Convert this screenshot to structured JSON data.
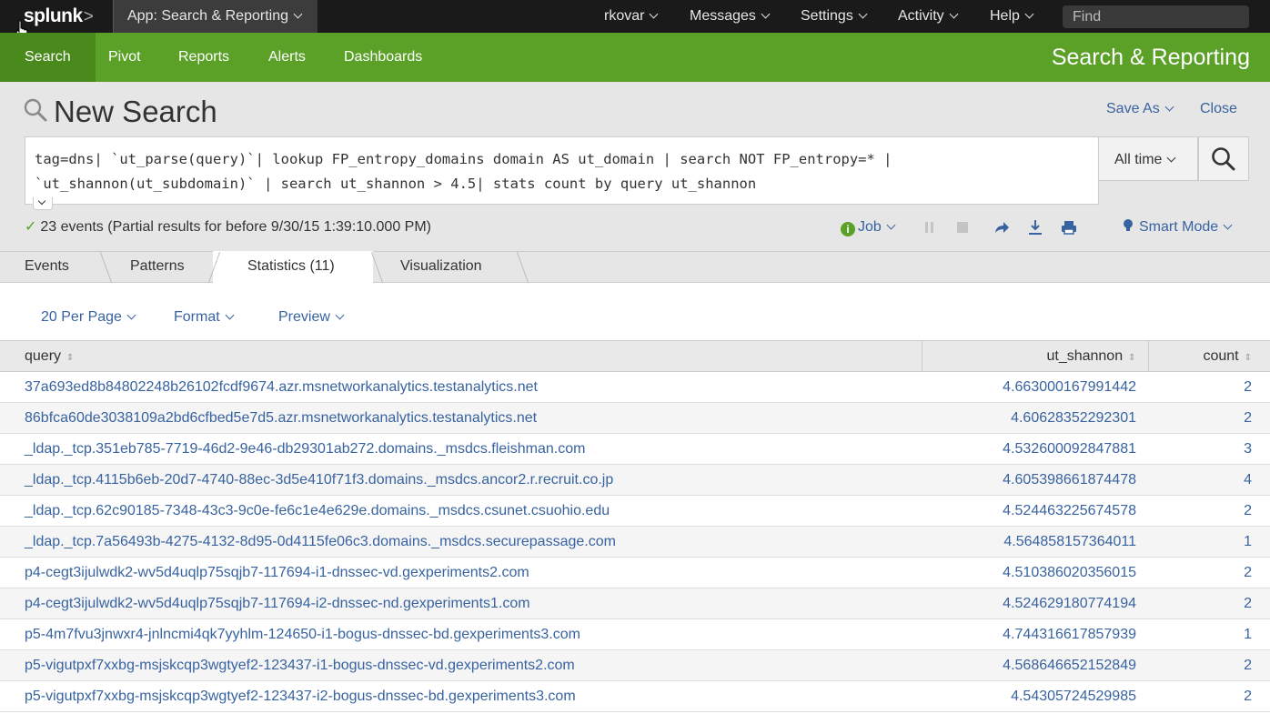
{
  "topbar": {
    "logo": "splunk",
    "logo_suffix": ">",
    "app_menu": "App: Search & Reporting",
    "user": "rkovar",
    "messages": "Messages",
    "settings": "Settings",
    "activity": "Activity",
    "help": "Help",
    "find_placeholder": "Find"
  },
  "appnav": {
    "items": [
      "Search",
      "Pivot",
      "Reports",
      "Alerts",
      "Dashboards"
    ],
    "app_title": "Search & Reporting"
  },
  "search": {
    "page_title": "New Search",
    "save_as": "Save As",
    "close": "Close",
    "query_line1": "tag=dns| `ut_parse(query)`| lookup FP_entropy_domains domain AS ut_domain | search NOT FP_entropy=* |",
    "query_line2": "`ut_shannon(ut_subdomain)` | search ut_shannon > 4.5| stats count by query ut_shannon",
    "time_range": "All time",
    "status_text": "23 events (Partial results for before 9/30/15 1:39:10.000 PM)",
    "job_label": "Job",
    "smart_mode": "Smart Mode"
  },
  "tabs": [
    {
      "label": "Events"
    },
    {
      "label": "Patterns"
    },
    {
      "label": "Statistics (11)"
    },
    {
      "label": "Visualization"
    }
  ],
  "controls": {
    "per_page": "20 Per Page",
    "format": "Format",
    "preview": "Preview"
  },
  "table": {
    "headers": [
      "query",
      "ut_shannon",
      "count"
    ],
    "rows": [
      [
        "37a693ed8b84802248b26102fcdf9674.azr.msnetworkanalytics.testanalytics.net",
        "4.663000167991442",
        "2"
      ],
      [
        "86bfca60de3038109a2bd6cfbed5e7d5.azr.msnetworkanalytics.testanalytics.net",
        "4.60628352292301",
        "2"
      ],
      [
        "_ldap._tcp.351eb785-7719-46d2-9e46-db29301ab272.domains._msdcs.fleishman.com",
        "4.532600092847881",
        "3"
      ],
      [
        "_ldap._tcp.4115b6eb-20d7-4740-88ec-3d5e410f71f3.domains._msdcs.ancor2.r.recruit.co.jp",
        "4.605398661874478",
        "4"
      ],
      [
        "_ldap._tcp.62c90185-7348-43c3-9c0e-fe6c1e4e629e.domains._msdcs.csunet.csuohio.edu",
        "4.524463225674578",
        "2"
      ],
      [
        "_ldap._tcp.7a56493b-4275-4132-8d95-0d4115fe06c3.domains._msdcs.securepassage.com",
        "4.564858157364011",
        "1"
      ],
      [
        "p4-cegt3ijulwdk2-wv5d4uqlp75sqjb7-117694-i1-dnssec-vd.gexperiments2.com",
        "4.510386020356015",
        "2"
      ],
      [
        "p4-cegt3ijulwdk2-wv5d4uqlp75sqjb7-117694-i2-dnssec-nd.gexperiments1.com",
        "4.524629180774194",
        "2"
      ],
      [
        "p5-4m7fvu3jnwxr4-jnlncmi4qk7yyhlm-124650-i1-bogus-dnssec-bd.gexperiments3.com",
        "4.744316617857939",
        "1"
      ],
      [
        "p5-vigutpxf7xxbg-msjskcqp3wgtyef2-123437-i1-bogus-dnssec-vd.gexperiments2.com",
        "4.568646652152849",
        "2"
      ],
      [
        "p5-vigutpxf7xxbg-msjskcqp3wgtyef2-123437-i2-bogus-dnssec-bd.gexperiments3.com",
        "4.54305724529985",
        "2"
      ]
    ]
  },
  "colors": {
    "accent_green": "#5ba127",
    "link_blue": "#3863a0",
    "topbar_bg": "#1a1a1a"
  }
}
